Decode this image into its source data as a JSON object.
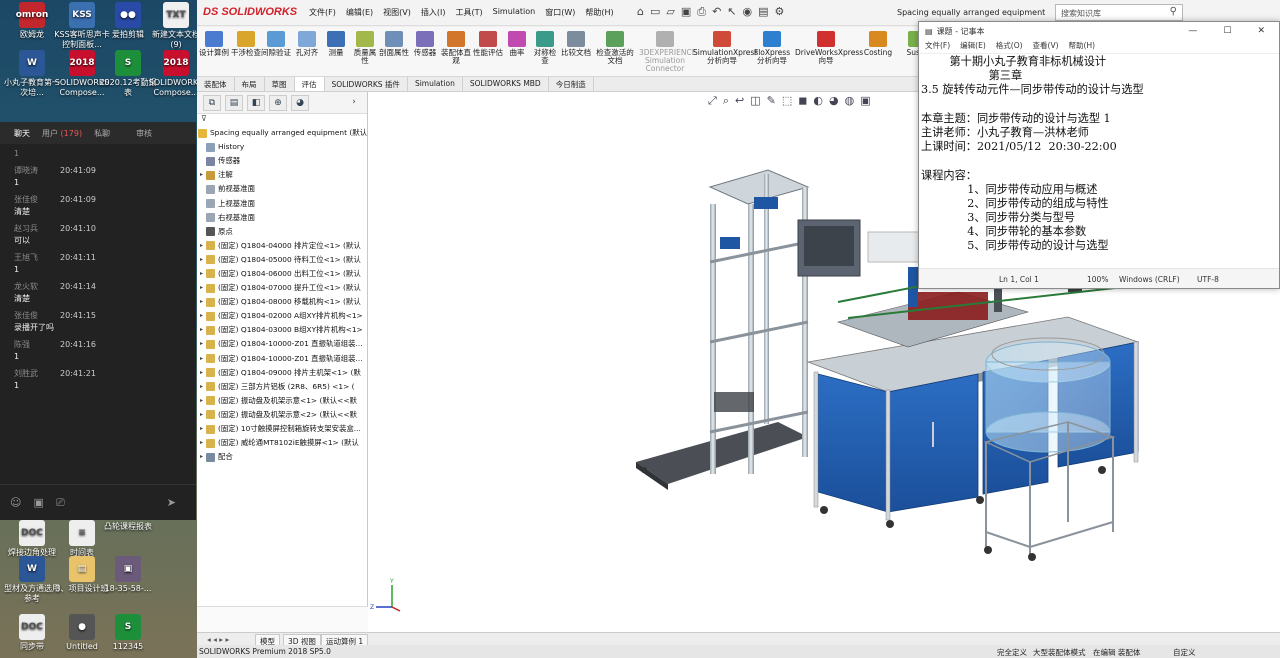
{
  "desktop": {
    "icons": [
      {
        "label": "欧姆龙",
        "badge": "omron",
        "color": "#c2272d"
      },
      {
        "label": "KSS客听思声卡控制面板...",
        "badge": "KSS",
        "color": "#3a6fb0"
      },
      {
        "label": "爱拍剪辑",
        "badge": "●●",
        "color": "#2a4aa8"
      },
      {
        "label": "新建文本文档 (9)",
        "badge": "TXT",
        "color": "#f0f0f0"
      },
      {
        "label": "小丸子教育第一次培...",
        "badge": "W",
        "color": "#2b5797"
      },
      {
        "label": "SOLIDWORKS Compose...",
        "badge": "2018",
        "color": "#c8102e"
      },
      {
        "label": "2020.12考勤报表",
        "badge": "S",
        "color": "#1d8f3a"
      },
      {
        "label": "SOLIDWORKS Compose...",
        "badge": "2018",
        "color": "#c8102e"
      },
      {
        "label": "焊接边角处理",
        "badge": "DOC",
        "color": "#eeeeee"
      },
      {
        "label": "时间表",
        "badge": "≡",
        "color": "#eeeeee"
      },
      {
        "label": "凸轮课程报表",
        "badge": "",
        "color": ""
      },
      {
        "label": "型材及方通选用参考",
        "badge": "W",
        "color": "#2b5797"
      },
      {
        "label": "3、项目设计班",
        "badge": "▤",
        "color": "#e8c36a"
      },
      {
        "label": "18-35-58-...",
        "badge": "▣",
        "color": "#6b5a7a"
      },
      {
        "label": "同步带",
        "badge": "DOC",
        "color": "#eeeeee"
      },
      {
        "label": "Untitled",
        "badge": "●",
        "color": "#555555"
      },
      {
        "label": "112345",
        "badge": "S",
        "color": "#1d8f3a"
      }
    ]
  },
  "chat": {
    "tabs": [
      "聊天",
      "用户",
      "(179)",
      "私聊",
      "审核"
    ],
    "messages": [
      {
        "who": "1",
        "time": "",
        "text": ""
      },
      {
        "who": "谭晓涛",
        "time": "20:41:09",
        "text": "1"
      },
      {
        "who": "张佳俊",
        "time": "20:41:09",
        "text": "清楚"
      },
      {
        "who": "赵习兵",
        "time": "20:41:10",
        "text": "可以"
      },
      {
        "who": "王旭飞",
        "time": "20:41:11",
        "text": "1"
      },
      {
        "who": "龙火软",
        "time": "20:41:14",
        "text": "清楚"
      },
      {
        "who": "张佳俊",
        "time": "20:41:15",
        "text": "录播开了吗"
      },
      {
        "who": "陈强",
        "time": "20:41:16",
        "text": "1"
      },
      {
        "who": "刘胜武",
        "time": "20:41:21",
        "text": "1"
      }
    ]
  },
  "sw": {
    "logo": "DS SOLIDWORKS",
    "menu": [
      "文件(F)",
      "编辑(E)",
      "视图(V)",
      "插入(I)",
      "工具(T)",
      "Simulation",
      "窗口(W)",
      "帮助(H)"
    ],
    "doc_title": "Spacing equally arranged equipment",
    "search_placeholder": "搜索知识库",
    "ribbon": [
      {
        "label": "设计算例",
        "color": "#4a7bd0"
      },
      {
        "label": "干涉检查",
        "color": "#d9a52b"
      },
      {
        "label": "间隙验证",
        "color": "#5b9bd5"
      },
      {
        "label": "孔对齐",
        "color": "#7fa7d8"
      },
      {
        "label": "测量",
        "color": "#3d6fb6"
      },
      {
        "label": "质量属性",
        "color": "#a3b84a"
      },
      {
        "label": "剖面属性",
        "color": "#6f8fb8"
      },
      {
        "label": "传感器",
        "color": "#7a6fb8"
      },
      {
        "label": "装配体直观",
        "color": "#d2762b"
      },
      {
        "label": "性能评估",
        "color": "#c14a4a"
      },
      {
        "label": "曲率",
        "color": "#c04ab0"
      },
      {
        "label": "对称检查",
        "color": "#3a9b8a"
      },
      {
        "label": "比较文档",
        "color": "#7c8c9c"
      },
      {
        "label": "检查激活的文档",
        "color": "#5ba05b"
      },
      {
        "label": "3DEXPERIENCE Simulation Connector",
        "color": "#b0b0b0"
      },
      {
        "label": "SimulationXpress 分析向导",
        "color": "#d04a3a"
      },
      {
        "label": "FloXpress 分析向导",
        "color": "#2d7fd0"
      },
      {
        "label": "DriveWorksXpress 向导",
        "color": "#d03030"
      },
      {
        "label": "Costing",
        "color": "#d88a20"
      },
      {
        "label": "Susta",
        "color": "#7ab04a"
      }
    ],
    "command_tabs": [
      "装配体",
      "布局",
      "草图",
      "评估",
      "SOLIDWORKS 插件",
      "Simulation",
      "SOLIDWORKS MBD",
      "今日制造"
    ],
    "active_tab": "评估",
    "tree": [
      {
        "text": "Spacing equally arranged equipment  (默认",
        "ex": "",
        "color": "#e7b73c"
      },
      {
        "text": "History",
        "ex": "",
        "color": "#8aa0b8"
      },
      {
        "text": "传感器",
        "ex": "",
        "color": "#7a86a0"
      },
      {
        "text": "注解",
        "ex": "▸",
        "color": "#c79a3a"
      },
      {
        "text": "前视基准面",
        "ex": "",
        "color": "#9aa6b4"
      },
      {
        "text": "上视基准面",
        "ex": "",
        "color": "#9aa6b4"
      },
      {
        "text": "右视基准面",
        "ex": "",
        "color": "#9aa6b4"
      },
      {
        "text": "原点",
        "ex": "",
        "color": "#555555"
      },
      {
        "text": "(固定) Q1804-04000 排片定位<1> (默认",
        "ex": "▸",
        "color": "#d8b24a"
      },
      {
        "text": "(固定) Q1804-05000 待料工位<1> (默认",
        "ex": "▸",
        "color": "#d8b24a"
      },
      {
        "text": "(固定) Q1804-06000 出料工位<1> (默认",
        "ex": "▸",
        "color": "#d8b24a"
      },
      {
        "text": "(固定) Q1804-07000 提升工位<1> (默认",
        "ex": "▸",
        "color": "#d8b24a"
      },
      {
        "text": "(固定) Q1804-08000 移载机构<1> (默认",
        "ex": "▸",
        "color": "#d8b24a"
      },
      {
        "text": "(固定) Q1804-02000 A组XY排片机构<1>",
        "ex": "▸",
        "color": "#d8b24a"
      },
      {
        "text": "(固定) Q1804-03000 B组XY排片机构<1>",
        "ex": "▸",
        "color": "#d8b24a"
      },
      {
        "text": "(固定) Q1804-10000-Z01 直振轨道组装...",
        "ex": "▸",
        "color": "#d8b24a"
      },
      {
        "text": "(固定) Q1804-10000-Z01 直振轨道组装...",
        "ex": "▸",
        "color": "#d8b24a"
      },
      {
        "text": "(固定) Q1804-09000 排片主机架<1> (默",
        "ex": "▸",
        "color": "#d8b24a"
      },
      {
        "text": "(固定) 三部方片铝板 (2R8、6R5) <1> (",
        "ex": "▸",
        "color": "#d8b24a"
      },
      {
        "text": "(固定) 振动盘及机架示意<1> (默认<<默",
        "ex": "▸",
        "color": "#d8b24a"
      },
      {
        "text": "(固定) 振动盘及机架示意<2> (默认<<默",
        "ex": "▸",
        "color": "#d8b24a"
      },
      {
        "text": "(固定) 10寸触摸屏控制箱旋转支架安装盒...",
        "ex": "▸",
        "color": "#d8b24a"
      },
      {
        "text": "(固定) 威纶通MT8102iE触摸屏<1> (默认",
        "ex": "▸",
        "color": "#d8b24a"
      },
      {
        "text": "配合",
        "ex": "▸",
        "color": "#7a8aa0"
      }
    ],
    "sheet_tabs": [
      "模型",
      "3D 视图",
      "运动算例 1"
    ],
    "status": {
      "product": "SOLIDWORKS Premium 2018 SP5.0",
      "s1": "完全定义",
      "s2": "大型装配体模式",
      "s3": "在编辑 装配体",
      "s4": "自定义"
    }
  },
  "notepad": {
    "title": "课题 - 记事本",
    "menu": [
      "文件(F)",
      "编辑(E)",
      "格式(O)",
      "查看(V)",
      "帮助(H)"
    ],
    "lines": [
      "        第十期小丸子教育非标机械设计",
      "                   第三章",
      "3.5 旋转传动元件—同步带传动的设计与选型",
      "",
      "本章主题：同步带传动的设计与选型 1",
      "主讲老师：小丸子教育—洪林老师",
      "上课时间：2021/05/12  20:30-22:00",
      "",
      "课程内容：",
      "             1、同步带传动应用与概述",
      "             2、同步带传动的组成与特性",
      "             3、同步带分类与型号",
      "             4、同步带轮的基本参数",
      "             5、同步带传动的设计与选型"
    ],
    "status": {
      "pos": "Ln 1, Col 1",
      "zoom": "100%",
      "eol": "Windows (CRLF)",
      "enc": "UTF-8"
    }
  }
}
